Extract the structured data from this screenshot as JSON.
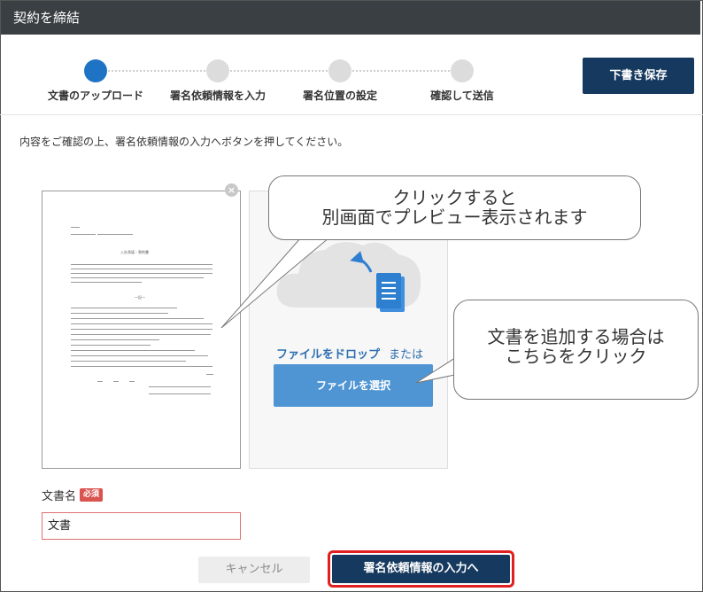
{
  "window": {
    "title": "契約を締結"
  },
  "steps": [
    {
      "label": "文書のアップロード",
      "active": true
    },
    {
      "label": "署名依頼情報を入力",
      "active": false
    },
    {
      "label": "署名位置の設定",
      "active": false
    },
    {
      "label": "確認して送信",
      "active": false
    }
  ],
  "toolbar": {
    "draft_label": "下書き保存"
  },
  "instruction": "内容をご確認の上、署名依頼情報の入力へボタンを押してください。",
  "document_preview": {
    "close_icon": "×",
    "heading": "入社承諾・誓約書",
    "section_title": "―記―"
  },
  "upload": {
    "drop_label": "ファイルをドロップ",
    "or_label": "または",
    "select_button": "ファイルを選択"
  },
  "callouts": {
    "preview_line1": "クリックすると",
    "preview_line2": "別画面でプレビュー表示されます",
    "add_line1": "文書を追加する場合は",
    "add_line2": "こちらをクリック"
  },
  "form": {
    "doc_name_label": "文書名",
    "required_badge": "必須",
    "doc_name_value": "文書"
  },
  "footer": {
    "cancel_label": "キャンセル",
    "next_label": "署名依頼情報の入力へ"
  },
  "colors": {
    "titlebar": "#3a3f44",
    "primary_dark": "#163a5f",
    "step_active": "#1f73c4",
    "select_button": "#4f95d4",
    "highlight": "#e02020",
    "required": "#d9534f"
  }
}
